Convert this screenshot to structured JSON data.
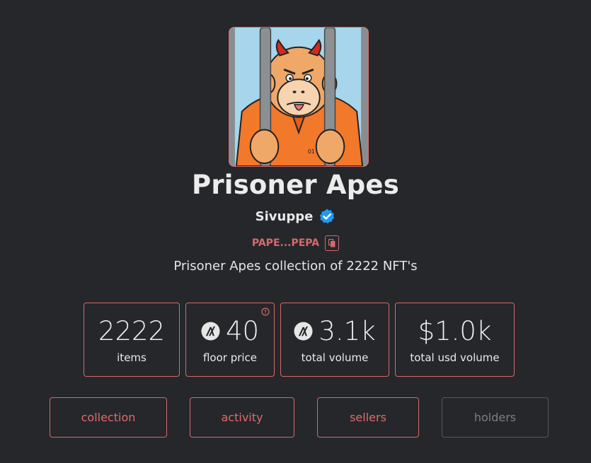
{
  "collection": {
    "title": "Prisoner Apes",
    "creator": "Sivuppe",
    "address": "PAPE...PEPA",
    "description": "Prisoner Apes collection of 2222 NFT's"
  },
  "stats": [
    {
      "value": "2222",
      "label": "items",
      "icon": ""
    },
    {
      "value": "40",
      "label": "floor price",
      "icon": "algorand-icon"
    },
    {
      "value": "3.1k",
      "label": "total volume",
      "icon": "algorand-icon"
    },
    {
      "value": "$1.0k",
      "label": "total usd volume",
      "icon": ""
    }
  ],
  "tabs": [
    {
      "label": "collection"
    },
    {
      "label": "activity"
    },
    {
      "label": "sellers"
    },
    {
      "label": "holders"
    }
  ],
  "colors": {
    "background": "#25272b",
    "accent": "#d36a6a",
    "verified": "#1d9bf0"
  }
}
